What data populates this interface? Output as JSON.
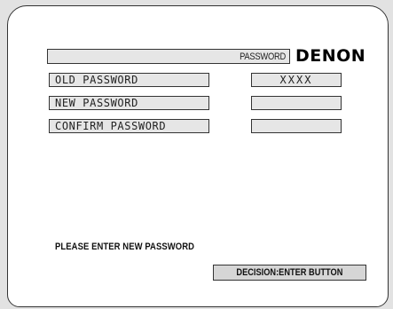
{
  "header": {
    "title": "PASSWORD",
    "brand": "DENON"
  },
  "fields": [
    {
      "label": "OLD PASSWORD",
      "value": "XXXX"
    },
    {
      "label": "NEW PASSWORD",
      "value": ""
    },
    {
      "label": "CONFIRM PASSWORD",
      "value": ""
    }
  ],
  "status": {
    "message": "PLEASE ENTER NEW PASSWORD",
    "decision": "DECISION:ENTER BUTTON"
  }
}
